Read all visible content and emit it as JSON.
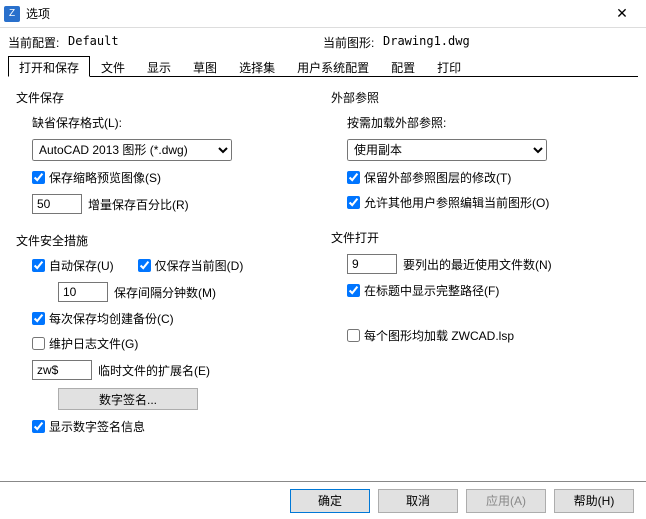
{
  "titlebar": {
    "title": "选项",
    "close": "✕"
  },
  "profile": {
    "current_profile_label": "当前配置:",
    "current_profile_value": "Default",
    "current_drawing_label": "当前图形:",
    "current_drawing_value": "Drawing1.dwg"
  },
  "tabs": [
    "打开和保存",
    "文件",
    "显示",
    "草图",
    "选择集",
    "用户系统配置",
    "配置",
    "打印"
  ],
  "active_tab": "打开和保存",
  "file_save": {
    "title": "文件保存",
    "format_label": "缺省保存格式(L):",
    "format_value": "AutoCAD 2013 图形 (*.dwg)",
    "thumb_label": "保存缩略预览图像(S)",
    "thumb_checked": true,
    "inc_value": "50",
    "inc_label": "增量保存百分比(R)"
  },
  "file_safety": {
    "title": "文件安全措施",
    "auto_save_label": "自动保存(U)",
    "auto_save_checked": true,
    "current_only_label": "仅保存当前图(D)",
    "current_only_checked": true,
    "interval_value": "10",
    "interval_label": "保存间隔分钟数(M)",
    "backup_label": "每次保存均创建备份(C)",
    "backup_checked": true,
    "log_label": "维护日志文件(G)",
    "log_checked": false,
    "ext_value": "zw$",
    "ext_label": "临时文件的扩展名(E)",
    "sig_button": "数字签名...",
    "show_sig_label": "显示数字签名信息",
    "show_sig_checked": true
  },
  "xref": {
    "title": "外部参照",
    "load_label": "按需加载外部参照:",
    "load_value": "使用副本",
    "retain_label": "保留外部参照图层的修改(T)",
    "retain_checked": true,
    "allow_edit_label": "允许其他用户参照编辑当前图形(O)",
    "allow_edit_checked": true
  },
  "file_open": {
    "title": "文件打开",
    "recent_value": "9",
    "recent_label": "要列出的最近使用文件数(N)",
    "fullpath_label": "在标题中显示完整路径(F)",
    "fullpath_checked": true
  },
  "misc": {
    "load_lsp_label": "每个图形均加载 ZWCAD.lsp",
    "load_lsp_checked": false
  },
  "footer": {
    "ok": "确定",
    "cancel": "取消",
    "apply": "应用(A)",
    "help": "帮助(H)"
  }
}
